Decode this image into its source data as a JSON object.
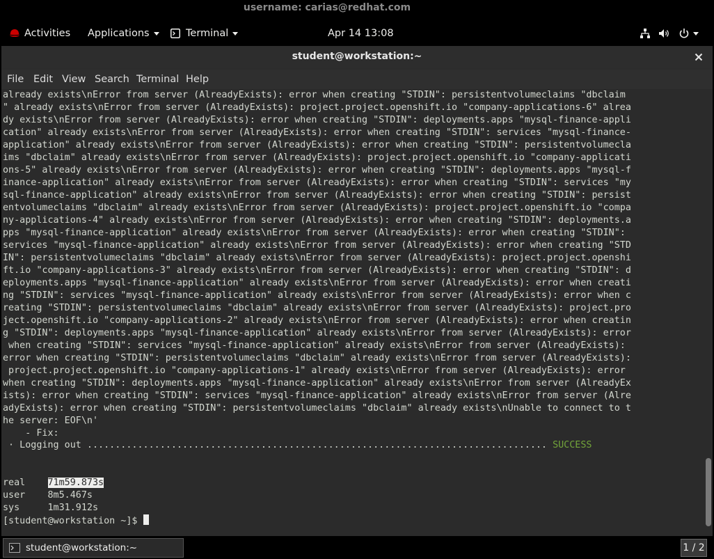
{
  "watermark": "username: carias@redhat.com",
  "topbar": {
    "activities": "Activities",
    "applications": "Applications",
    "terminal": "Terminal",
    "clock": "Apr 14  13:08"
  },
  "window": {
    "title": "student@workstation:~",
    "menu": [
      "File",
      "Edit",
      "View",
      "Search",
      "Terminal",
      "Help"
    ]
  },
  "terminal": {
    "lines": [
      "already exists\\nError from server (AlreadyExists): error when creating \"STDIN\": persistentvolumeclaims \"dbclaim",
      "\" already exists\\nError from server (AlreadyExists): project.project.openshift.io \"company-applications-6\" alrea",
      "dy exists\\nError from server (AlreadyExists): error when creating \"STDIN\": deployments.apps \"mysql-finance-appli",
      "cation\" already exists\\nError from server (AlreadyExists): error when creating \"STDIN\": services \"mysql-finance-",
      "application\" already exists\\nError from server (AlreadyExists): error when creating \"STDIN\": persistentvolumecla",
      "ims \"dbclaim\" already exists\\nError from server (AlreadyExists): project.project.openshift.io \"company-applicati",
      "ons-5\" already exists\\nError from server (AlreadyExists): error when creating \"STDIN\": deployments.apps \"mysql-f",
      "inance-application\" already exists\\nError from server (AlreadyExists): error when creating \"STDIN\": services \"my",
      "sql-finance-application\" already exists\\nError from server (AlreadyExists): error when creating \"STDIN\": persist",
      "entvolumeclaims \"dbclaim\" already exists\\nError from server (AlreadyExists): project.project.openshift.io \"compa",
      "ny-applications-4\" already exists\\nError from server (AlreadyExists): error when creating \"STDIN\": deployments.a",
      "pps \"mysql-finance-application\" already exists\\nError from server (AlreadyExists): error when creating \"STDIN\":",
      "services \"mysql-finance-application\" already exists\\nError from server (AlreadyExists): error when creating \"STD",
      "IN\": persistentvolumeclaims \"dbclaim\" already exists\\nError from server (AlreadyExists): project.project.openshi",
      "ft.io \"company-applications-3\" already exists\\nError from server (AlreadyExists): error when creating \"STDIN\": d",
      "eployments.apps \"mysql-finance-application\" already exists\\nError from server (AlreadyExists): error when creati",
      "ng \"STDIN\": services \"mysql-finance-application\" already exists\\nError from server (AlreadyExists): error when c",
      "reating \"STDIN\": persistentvolumeclaims \"dbclaim\" already exists\\nError from server (AlreadyExists): project.pro",
      "ject.openshift.io \"company-applications-2\" already exists\\nError from server (AlreadyExists): error when creatin",
      "g \"STDIN\": deployments.apps \"mysql-finance-application\" already exists\\nError from server (AlreadyExists): error",
      " when creating \"STDIN\": services \"mysql-finance-application\" already exists\\nError from server (AlreadyExists):",
      "error when creating \"STDIN\": persistentvolumeclaims \"dbclaim\" already exists\\nError from server (AlreadyExists):",
      " project.project.openshift.io \"company-applications-1\" already exists\\nError from server (AlreadyExists): error",
      "when creating \"STDIN\": deployments.apps \"mysql-finance-application\" already exists\\nError from server (AlreadyEx",
      "ists): error when creating \"STDIN\": services \"mysql-finance-application\" already exists\\nError from server (Alre",
      "adyExists): error when creating \"STDIN\": persistentvolumeclaims \"dbclaim\" already exists\\nUnable to connect to t",
      "he server: EOF\\n'",
      "    - Fix:"
    ],
    "logging_out": " · Logging out .................................................................................. ",
    "success": "SUCCESS",
    "real_label": "real",
    "real_value": "71m59.873s",
    "user_label": "user",
    "user_value": "8m5.467s",
    "sys_label": "sys",
    "sys_value": "1m31.912s",
    "prompt": "[student@workstation ~]$ "
  },
  "taskbar": {
    "task_label": "student@workstation:~",
    "workspace": "1 / 2"
  }
}
